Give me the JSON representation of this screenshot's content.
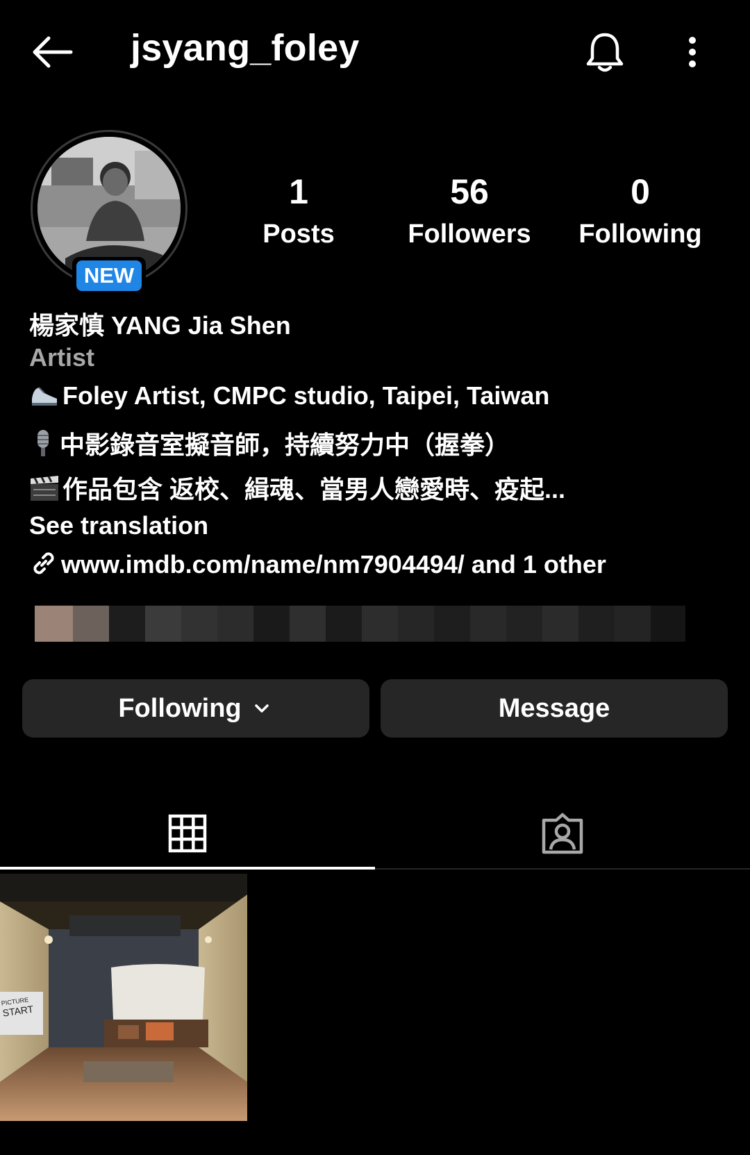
{
  "header": {
    "username": "jsyang_foley",
    "back_icon": "arrow-left-icon",
    "bell_icon": "bell-icon",
    "more_icon": "more-vertical-icon"
  },
  "profile": {
    "badge": "NEW",
    "stats": [
      {
        "value": "1",
        "label": "Posts"
      },
      {
        "value": "56",
        "label": "Followers"
      },
      {
        "value": "0",
        "label": "Following"
      }
    ],
    "name": "楊家慎 YANG Jia Shen",
    "category": "Artist",
    "bio_lines": [
      "Foley Artist, CMPC studio, Taipei, Taiwan",
      "中影錄音室擬音師，持續努力中（握拳）",
      "作品包含 返校、緝魂、當男人戀愛時、疫起..."
    ],
    "bio_icons": [
      "shoe-icon",
      "microphone-icon",
      "clapperboard-icon"
    ],
    "see_translation": "See translation",
    "link_icon": "link-icon",
    "link_text": "www.imdb.com/name/nm7904494/ and 1 other"
  },
  "actions": {
    "following_label": "Following",
    "message_label": "Message"
  },
  "tabs": {
    "grid_icon": "grid-icon",
    "tagged_icon": "tagged-person-icon"
  },
  "colors": {
    "background": "#000000",
    "button_bg": "#262626",
    "badge_blue": "#1f86e6",
    "muted_text": "#a8a8a8"
  }
}
